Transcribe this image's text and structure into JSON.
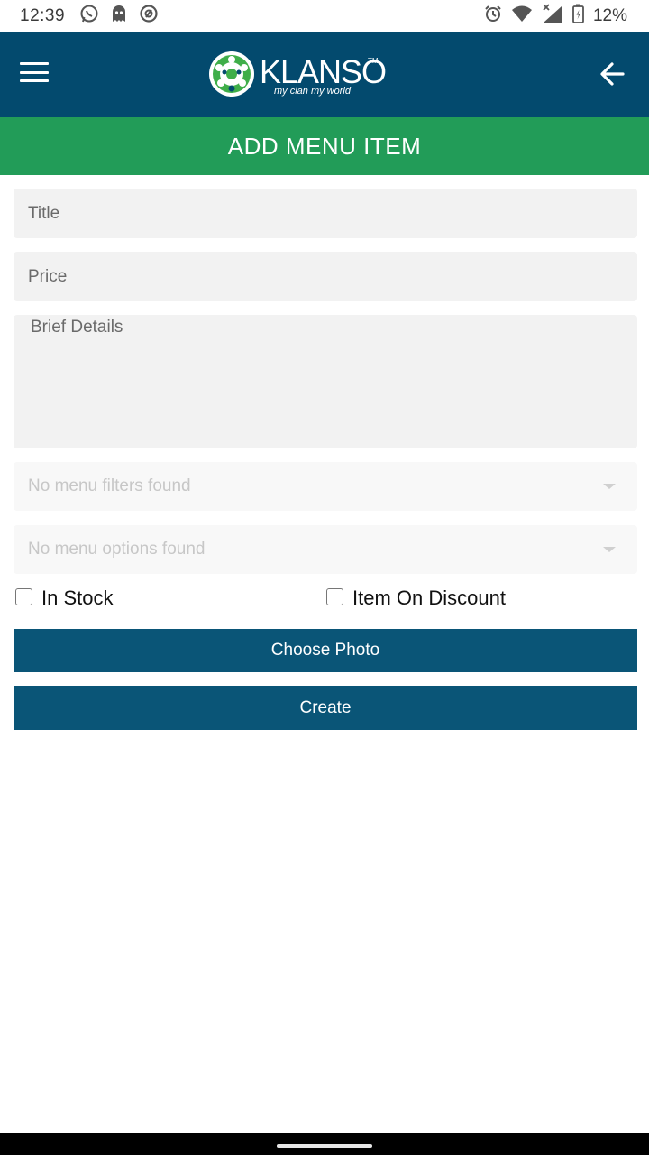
{
  "status_bar": {
    "time": "12:39",
    "battery_percent": "12%",
    "icons": [
      "whatsapp-icon",
      "ghost-icon",
      "circle-a-icon",
      "alarm-icon",
      "wifi-icon",
      "signal-icon",
      "battery-icon"
    ]
  },
  "header": {
    "logo_text": "KLANSO",
    "logo_tm": "TM",
    "logo_tagline": "my clan my world",
    "brand_color": "#034a6e"
  },
  "page": {
    "title": "ADD MENU ITEM",
    "title_bar_color": "#229c58"
  },
  "form": {
    "title_placeholder": "Title",
    "title_value": "",
    "price_placeholder": "Price",
    "price_value": "",
    "details_placeholder": "Brief Details",
    "details_value": "",
    "filters_select_text": "No menu filters found",
    "options_select_text": "No menu options found",
    "in_stock_label": "In Stock",
    "in_stock_checked": false,
    "discount_label": "Item On Discount",
    "discount_checked": false,
    "choose_photo_label": "Choose Photo",
    "create_label": "Create",
    "button_color": "#0a5577"
  }
}
